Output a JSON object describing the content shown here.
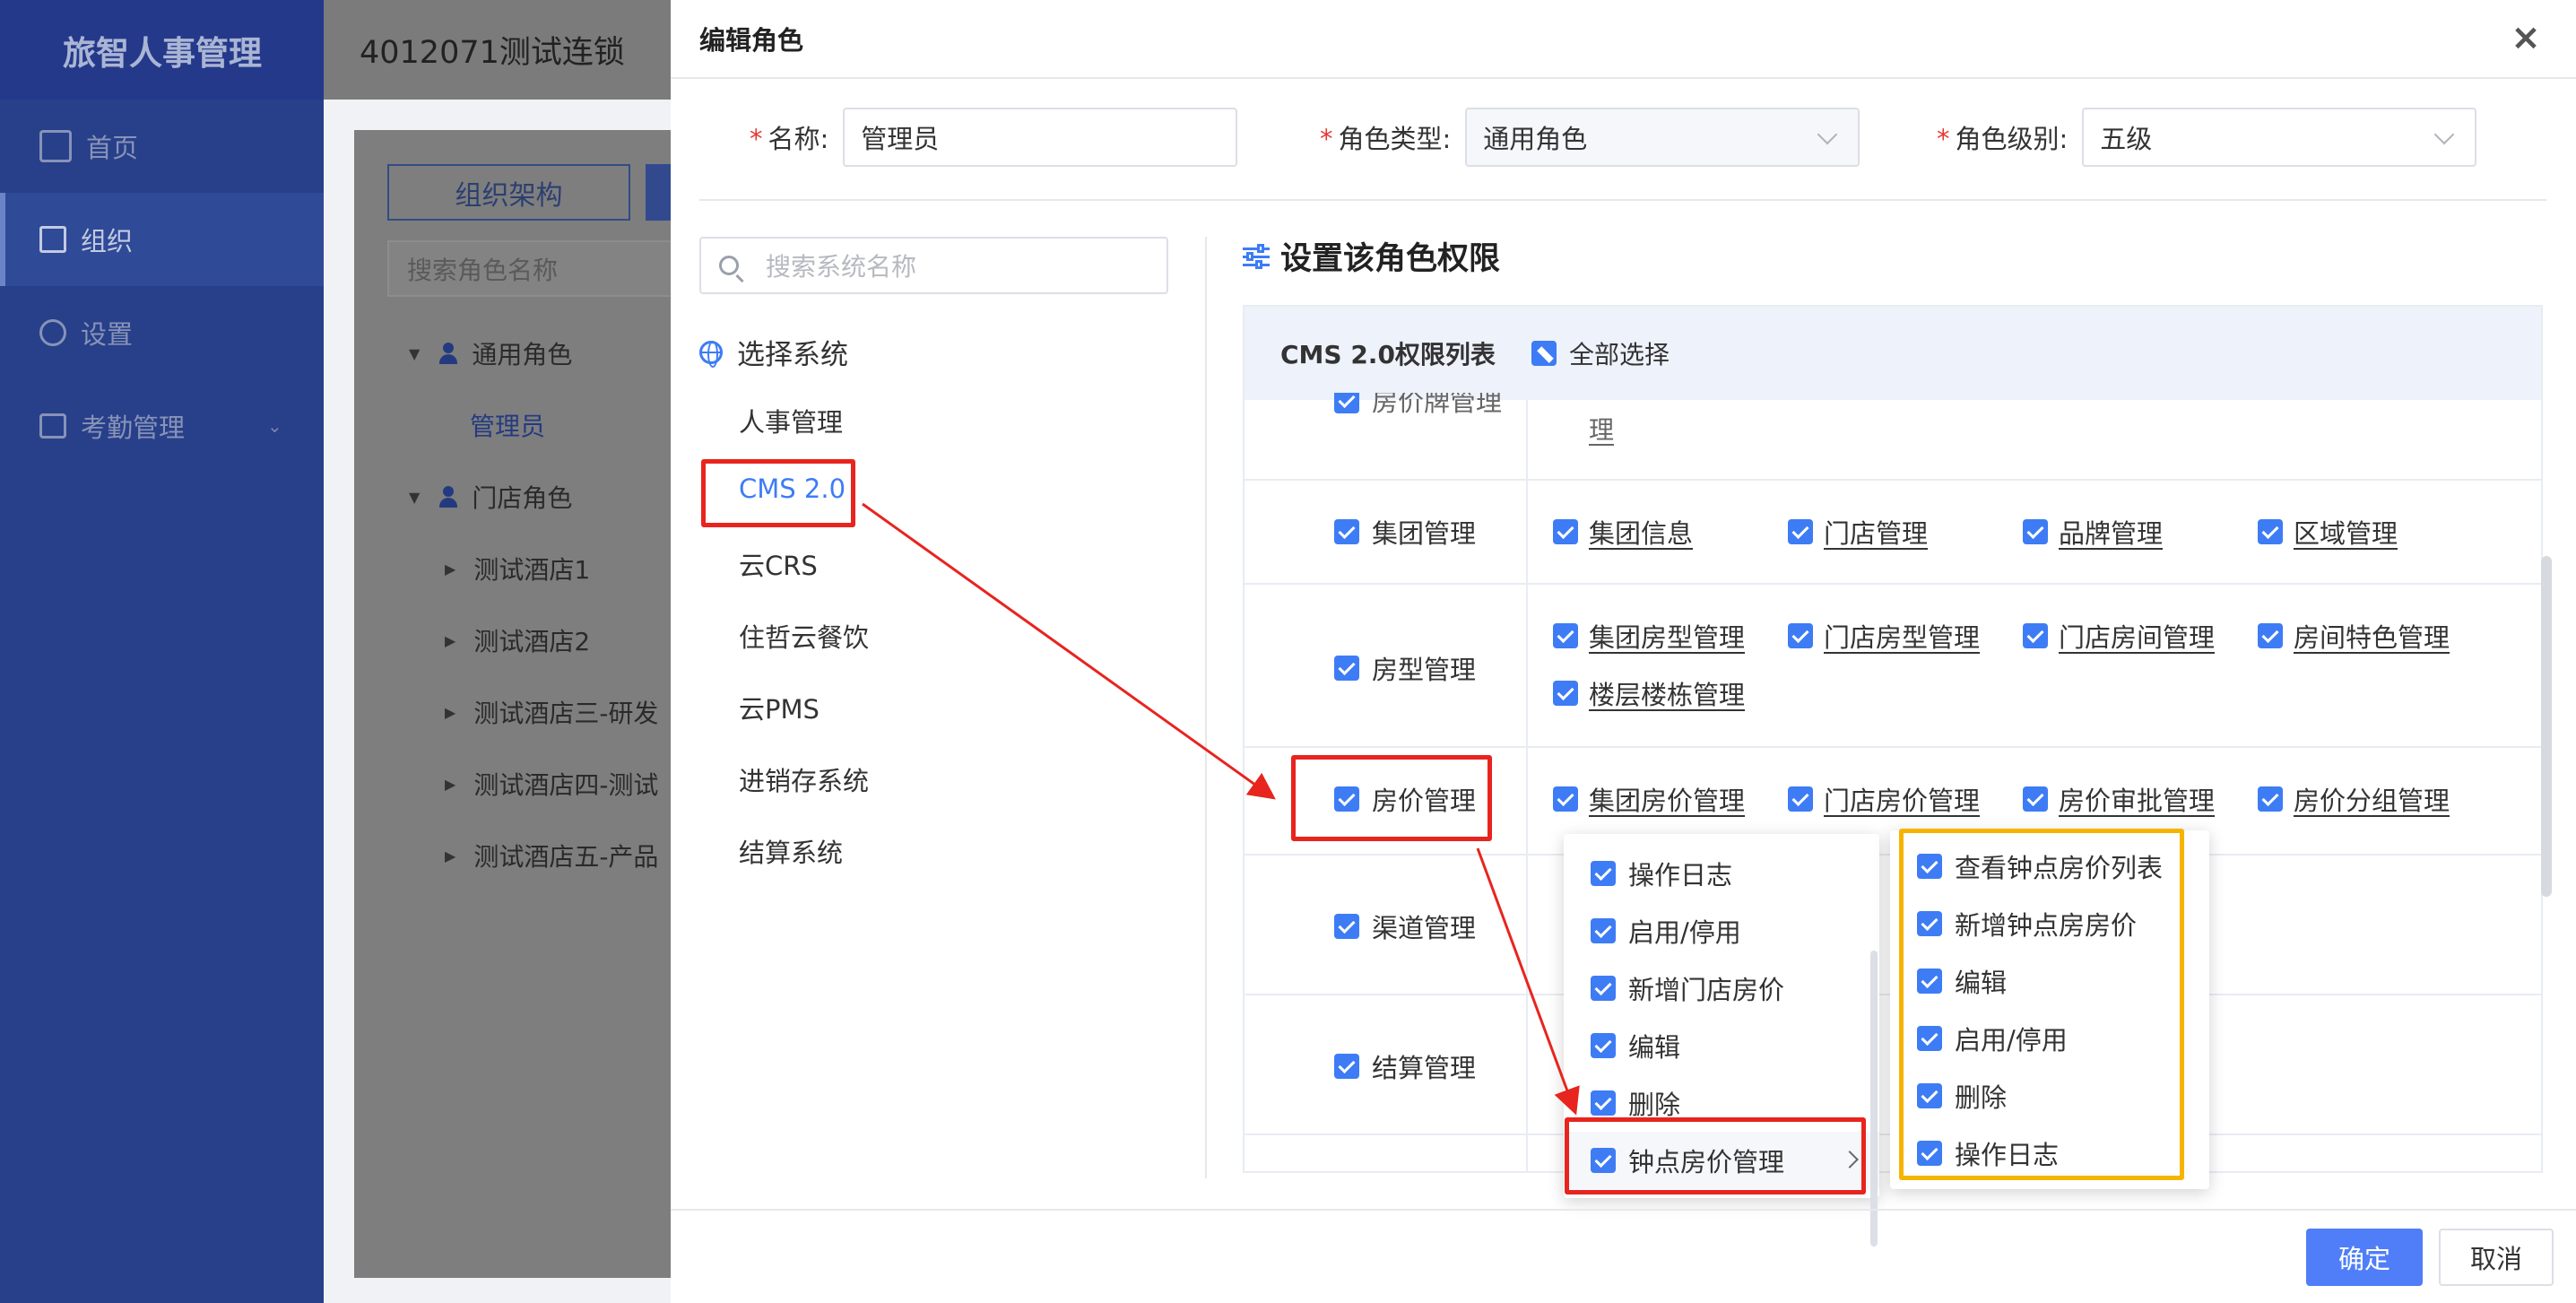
{
  "app": {
    "brand": "旅智人事管理",
    "header_title": "4012071测试连锁",
    "nav": [
      {
        "label": "首页",
        "icon": "chart-icon"
      },
      {
        "label": "组织",
        "icon": "org-icon"
      },
      {
        "label": "设置",
        "icon": "gear-icon"
      },
      {
        "label": "考勤管理",
        "icon": "calendar-icon"
      }
    ],
    "org_button": "组织架构",
    "role_search_placeholder": "搜索角色名称",
    "tree": {
      "general_group": "通用角色",
      "general_child": "管理员",
      "store_group": "门店角色",
      "stores": [
        "测试酒店1",
        "测试酒店2",
        "测试酒店三-研发",
        "测试酒店四-测试",
        "测试酒店五-产品"
      ]
    }
  },
  "modal": {
    "title": "编辑角色",
    "close_icon": "close-icon",
    "fields": {
      "name_label": "名称:",
      "name_value": "管理员",
      "type_label": "角色类型:",
      "type_value": "通用角色",
      "level_label": "角色级别:",
      "level_value": "五级",
      "required_mark": "*"
    },
    "system_search_placeholder": "搜索系统名称",
    "system_title": "选择系统",
    "systems": [
      "人事管理",
      "CMS 2.0",
      "云CRS",
      "住哲云餐饮",
      "云PMS",
      "进销存系统",
      "结算系统"
    ],
    "selected_system": "CMS 2.0",
    "perm_title": "设置该角色权限",
    "table_title": "CMS 2.0权限列表",
    "select_all": "全部选择",
    "partial_top_cat": "房价牌管理",
    "partial_top_item": "理",
    "rows": [
      {
        "category": "集团管理",
        "items": [
          "集团信息",
          "门店管理",
          "品牌管理",
          "区域管理"
        ]
      },
      {
        "category": "房型管理",
        "items": [
          "集团房型管理",
          "门店房型管理",
          "门店房间管理",
          "房间特色管理",
          "楼层楼栋管理"
        ]
      },
      {
        "category": "房价管理",
        "items": [
          "集团房价管理",
          "门店房价管理",
          "房价审批管理",
          "房价分组管理"
        ]
      },
      {
        "category": "渠道管理",
        "items": []
      },
      {
        "category": "结算管理",
        "items": []
      }
    ],
    "submenu_1": [
      "操作日志",
      "启用/停用",
      "新增门店房价",
      "编辑",
      "删除",
      "钟点房价管理"
    ],
    "submenu_2": [
      "查看钟点房价列表",
      "新增钟点房房价",
      "编辑",
      "启用/停用",
      "删除",
      "操作日志"
    ],
    "confirm": "确定",
    "cancel": "取消"
  },
  "colors": {
    "primary": "#3d7cf5",
    "sidebar": "#283f8a",
    "annotation_red": "#e8241e",
    "annotation_yellow": "#f5b400"
  }
}
